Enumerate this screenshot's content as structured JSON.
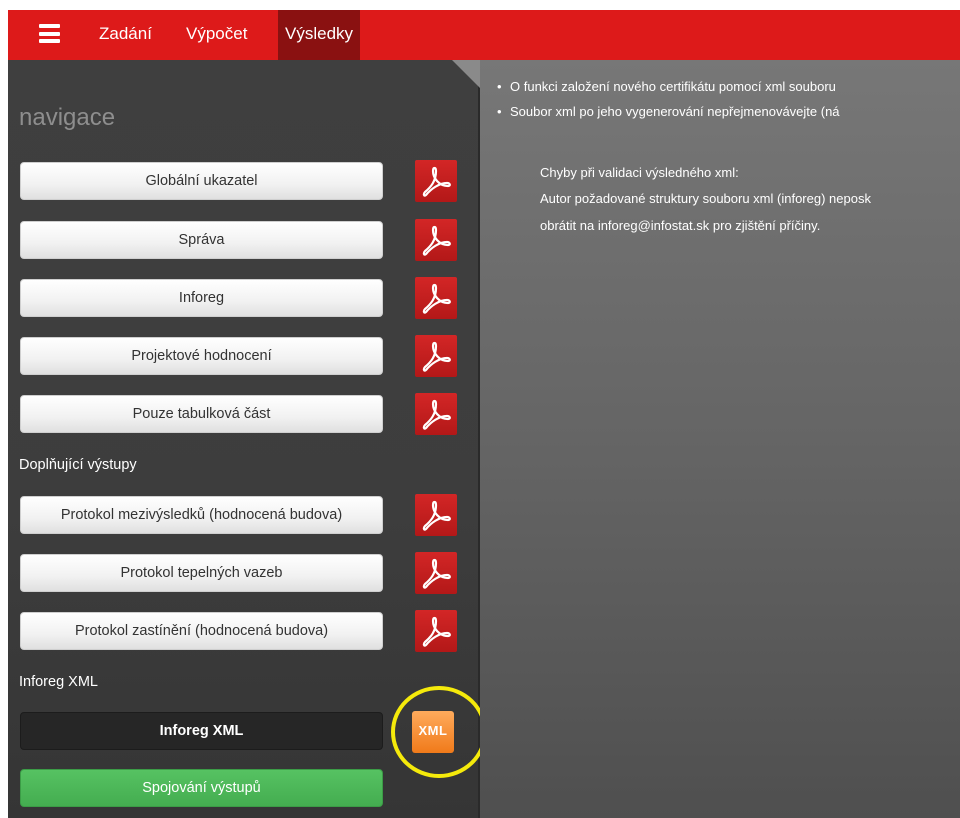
{
  "topbar": {
    "tabs": [
      "Zadání",
      "Výpočet",
      "Výsledky"
    ],
    "active_tab": "Výsledky"
  },
  "sidebar": {
    "title": "navigace",
    "main_buttons": [
      "Globální ukazatel",
      "Správa",
      "Inforeg",
      "Projektové hodnocení",
      "Pouze tabulková část"
    ],
    "supplementary_label": "Doplňující výstupy",
    "supplementary_buttons": [
      "Protokol mezivýsledků (hodnocená budova)",
      "Protokol tepelných vazeb",
      "Protokol zastínění (hodnocená budova)"
    ],
    "xml_label": "Inforeg XML",
    "xml_button": "Inforeg XML",
    "xml_icon_text": "XML",
    "merge_button": "Spojování výstupů"
  },
  "content": {
    "bullets": [
      "O funkci založení nového certifikátu pomocí xml souboru",
      "Soubor xml po jeho vygenerování nepřejmenovávejte (ná"
    ],
    "error_heading": "Chyby při validaci výsledného xml:",
    "error_line1": "Autor požadované struktury souboru xml (inforeg) neposk",
    "error_line2": "obrátit na inforeg@infostat.sk pro zjištění příčiny."
  },
  "colors": {
    "topbar": "#dd1a1a",
    "active_tab": "#8a1111",
    "sidebar": "#3d3d3d",
    "pdf_icon": "#c41e1e",
    "xml_icon": "#f28a2e",
    "merge_button": "#4cb85a",
    "highlight_ring": "#f5ea0b"
  },
  "icons": {
    "menu": "hamburger-icon",
    "pdf": "pdf-icon",
    "xml": "xml-file-icon"
  }
}
